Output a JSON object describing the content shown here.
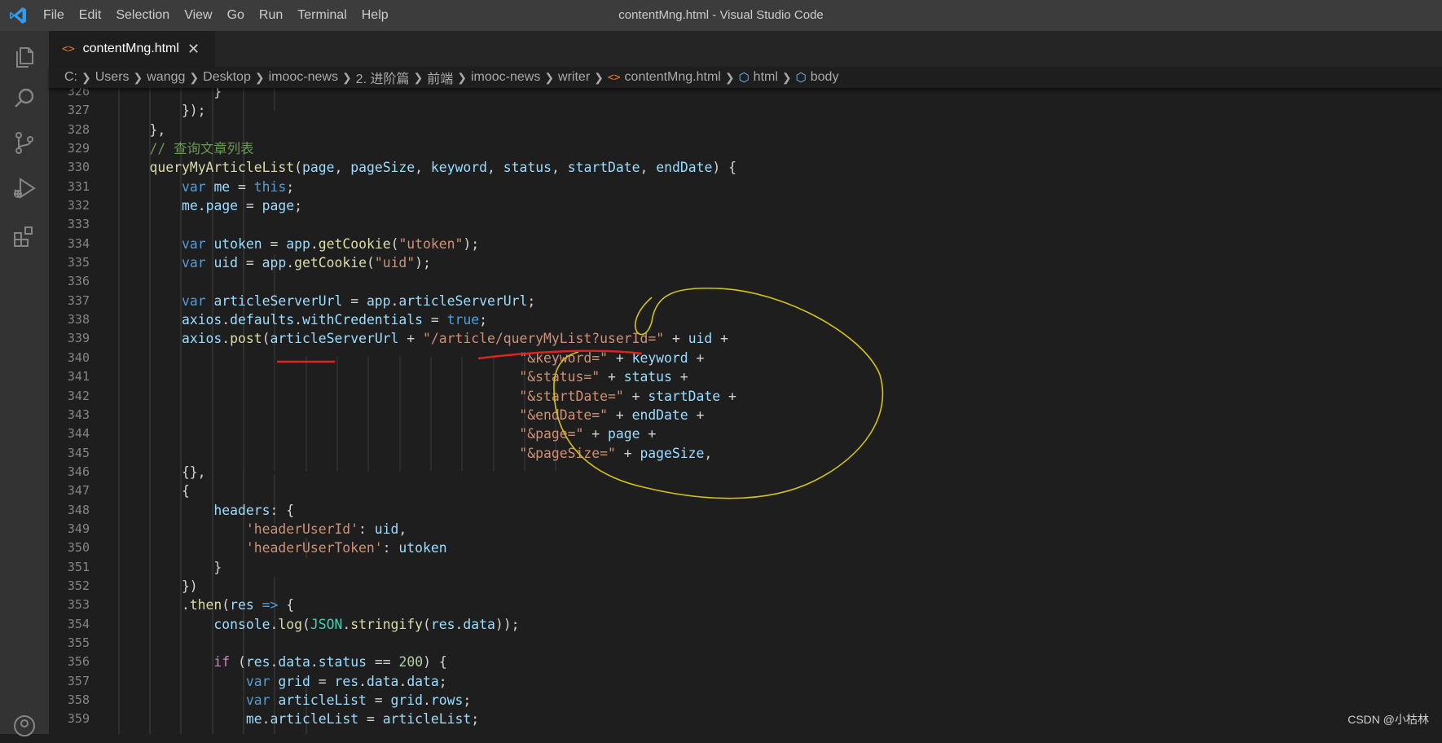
{
  "window": {
    "title": "contentMng.html - Visual Studio Code",
    "menu": [
      "File",
      "Edit",
      "Selection",
      "View",
      "Go",
      "Run",
      "Terminal",
      "Help"
    ]
  },
  "activity_bar": {
    "icons": [
      "explorer-icon",
      "search-icon",
      "source-control-icon",
      "run-debug-icon",
      "extensions-icon",
      "accounts-icon"
    ]
  },
  "tab": {
    "label": "contentMng.html",
    "icon": "html-file-icon",
    "close": "✕"
  },
  "breadcrumb": {
    "segments": [
      "C:",
      "Users",
      "wangg",
      "Desktop",
      "imooc-news",
      "2. 进阶篇",
      "前端",
      "imooc-news",
      "writer",
      "contentMng.html",
      "html",
      "body"
    ]
  },
  "editor": {
    "line_numbers": [
      "326",
      "327",
      "328",
      "329",
      "330",
      "331",
      "332",
      "333",
      "334",
      "335",
      "336",
      "337",
      "338",
      "339",
      "340",
      "341",
      "342",
      "343",
      "344",
      "345",
      "346",
      "347",
      "348",
      "349",
      "350",
      "351",
      "352",
      "353",
      "354",
      "355",
      "356",
      "357",
      "358",
      "359"
    ]
  },
  "watermark": "CSDN @小枯林",
  "colors": {
    "keyword": "#569cd6",
    "variable": "#9cdcfe",
    "function": "#dcdcaa",
    "string": "#ce9178",
    "comment": "#6a9955",
    "number": "#b5cea8",
    "annotation_circle": "#d4c21c",
    "annotation_underline": "#e0231f"
  }
}
